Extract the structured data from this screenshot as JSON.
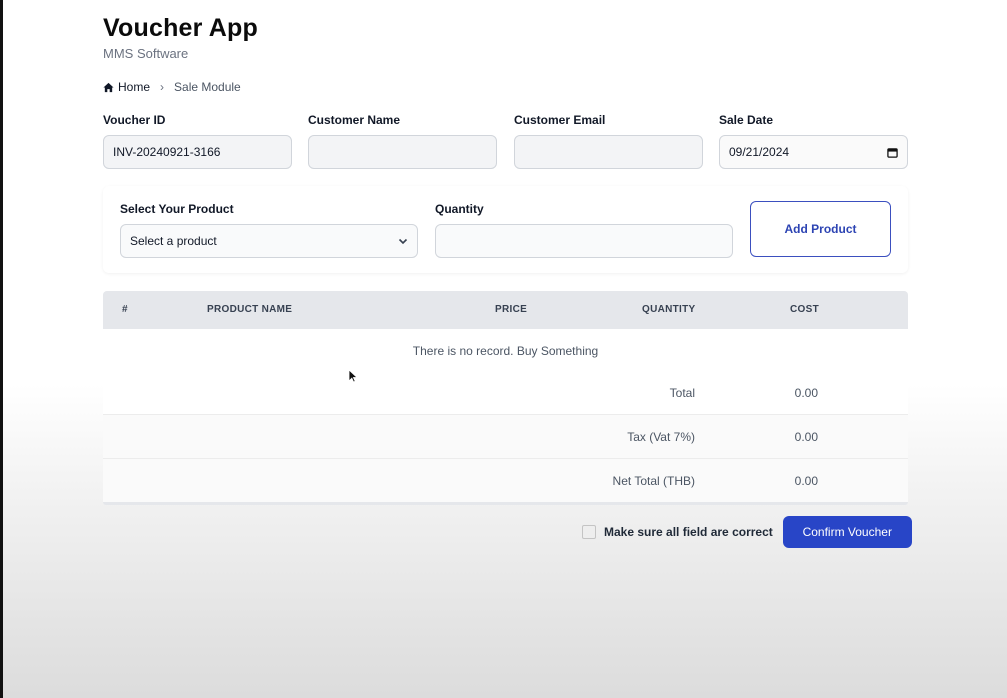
{
  "app": {
    "title": "Voucher App",
    "subtitle": "MMS Software"
  },
  "breadcrumb": {
    "home": "Home",
    "current": "Sale Module"
  },
  "form": {
    "voucher_id": {
      "label": "Voucher ID",
      "value": "INV-20240921-3166"
    },
    "customer_name": {
      "label": "Customer Name",
      "value": ""
    },
    "customer_email": {
      "label": "Customer Email",
      "value": ""
    },
    "sale_date": {
      "label": "Sale Date",
      "value": "09/21/2024"
    }
  },
  "product_form": {
    "product_label": "Select Your Product",
    "product_selected": "Select a product",
    "quantity_label": "Quantity",
    "quantity_value": "",
    "add_button": "Add Product"
  },
  "table": {
    "columns": [
      "#",
      "PRODUCT NAME",
      "PRICE",
      "QUANTITY",
      "COST"
    ],
    "empty_message": "There is no record. Buy Something",
    "summary": [
      {
        "label": "Total",
        "value": "0.00"
      },
      {
        "label": "Tax (Vat 7%)",
        "value": "0.00"
      },
      {
        "label": "Net Total (THB)",
        "value": "0.00"
      }
    ]
  },
  "confirm": {
    "checkbox_label": "Make sure all field are correct",
    "button": "Confirm Voucher"
  },
  "icons": {
    "home": "home-icon",
    "breadcrumb_separator": "chevron-right-icon",
    "select_caret": "chevron-down-icon",
    "date_picker": "calendar-icon",
    "pointer": "cursor-icon"
  },
  "colors": {
    "primary": "#2845c7",
    "table_header": "#e5e7eb"
  }
}
